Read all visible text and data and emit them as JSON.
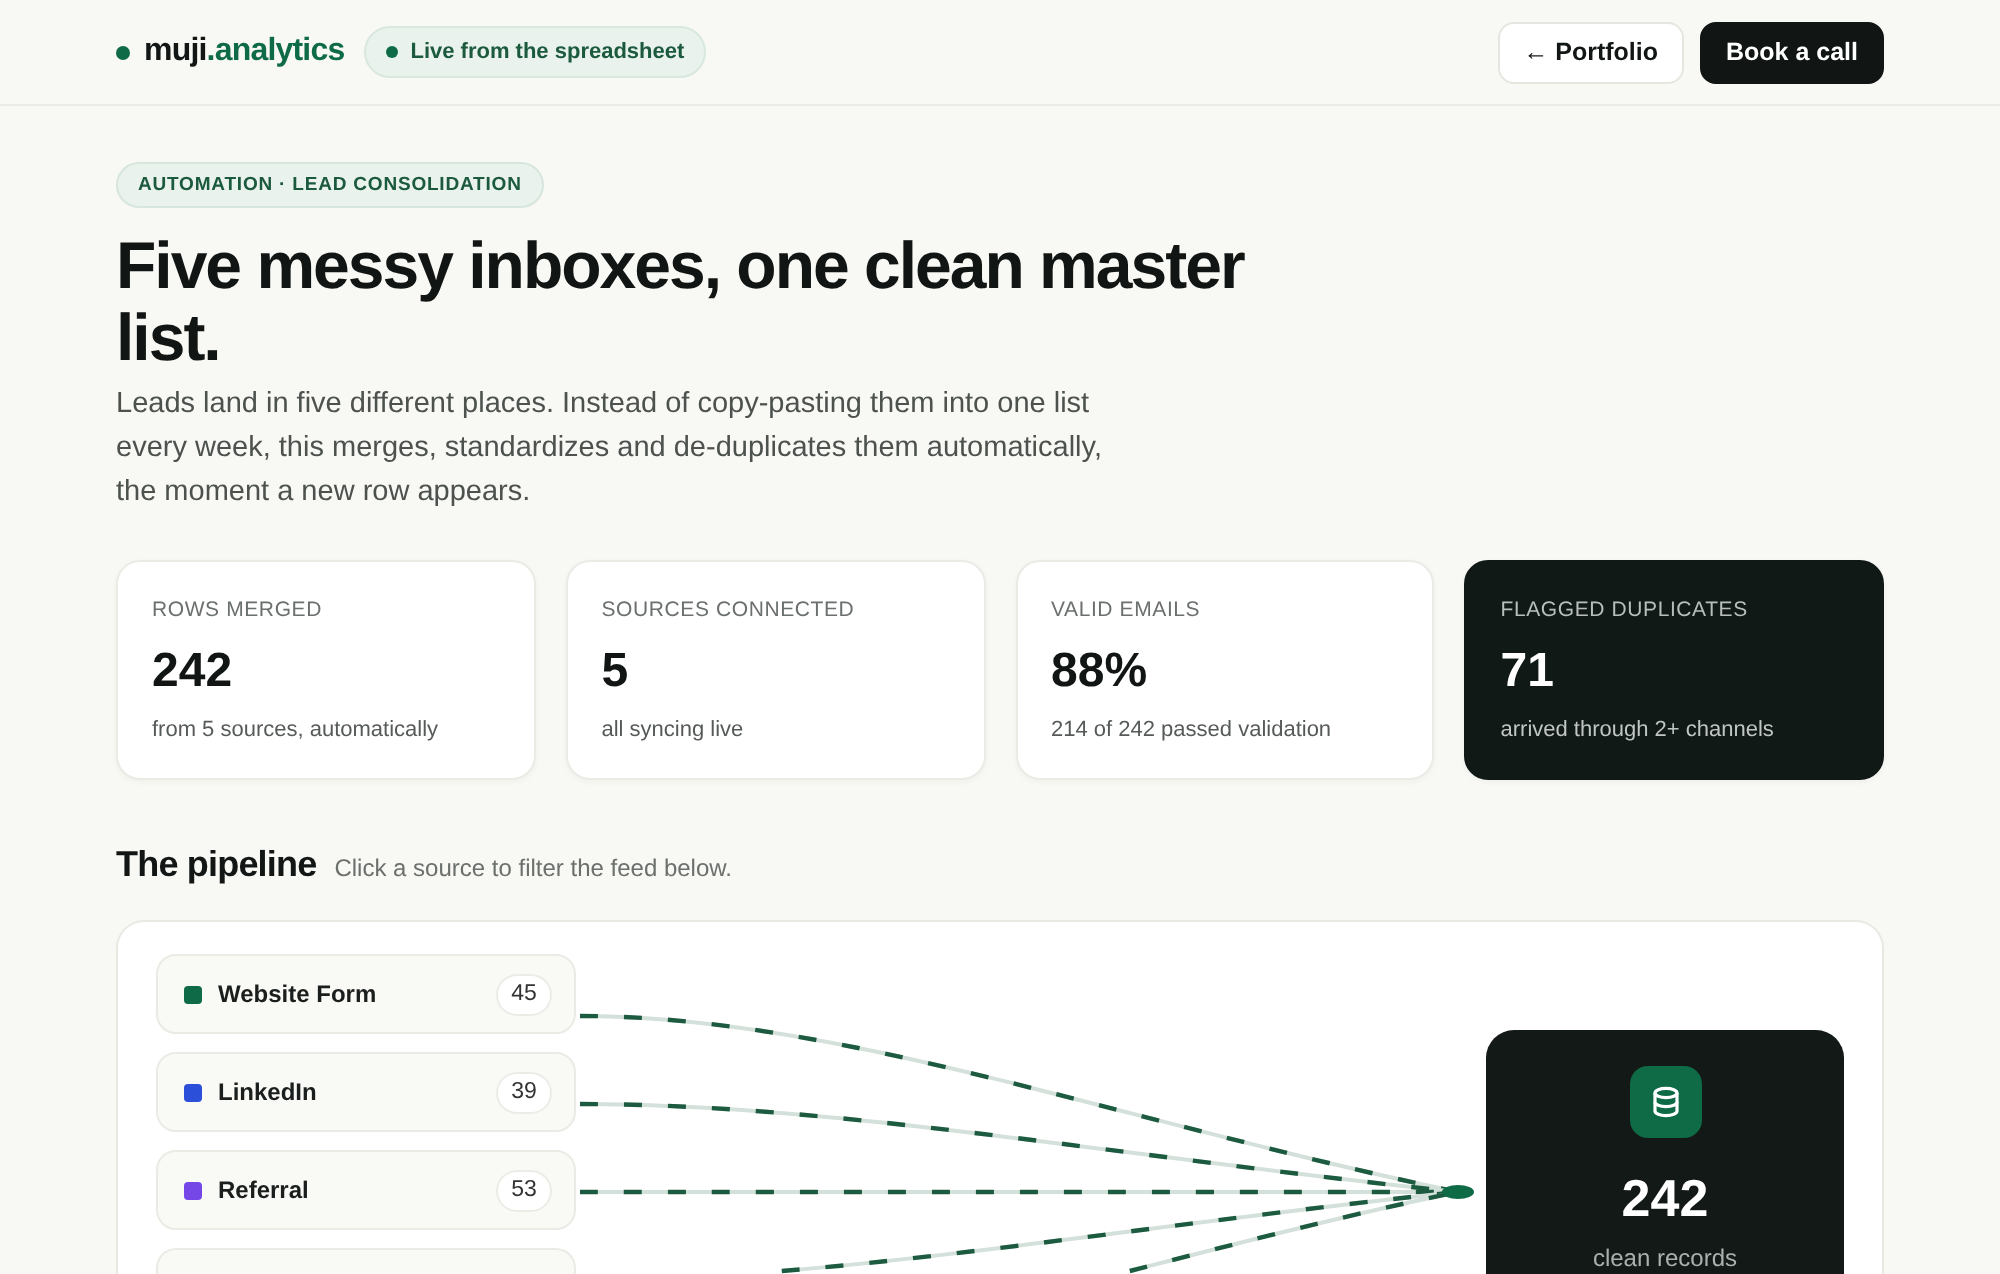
{
  "header": {
    "brand": {
      "primary": "muji",
      "accent": ".analytics"
    },
    "live_badge": {
      "label": "Live from the spreadsheet"
    },
    "buttons": [
      {
        "label": "← Portfolio",
        "kind": "secondary"
      },
      {
        "label": "Book a call",
        "kind": "primary"
      }
    ]
  },
  "hero": {
    "eyebrow": "AUTOMATION · LEAD CONSOLIDATION",
    "title": "Five messy inboxes, one clean master list.",
    "description": "Leads land in five different places. Instead of copy-pasting them into one list every week, this merges, standardizes and de-duplicates them automatically, the moment a new row appears."
  },
  "stats": [
    {
      "label": "ROWS MERGED",
      "value": "242",
      "note": "from 5 sources, automatically",
      "highlighted": false
    },
    {
      "label": "SOURCES CONNECTED",
      "value": "5",
      "note": "all syncing live",
      "highlighted": false
    },
    {
      "label": "VALID EMAILS",
      "value": "88%",
      "note": "214 of 242 passed validation",
      "highlighted": false
    },
    {
      "label": "FLAGGED DUPLICATES",
      "value": "71",
      "note": "arrived through 2+ channels",
      "highlighted": true
    }
  ],
  "pipeline": {
    "title": "The pipeline",
    "hint": "Click a source to filter the feed below.",
    "sources": [
      {
        "kind": "source",
        "name": "Website Form",
        "count": "45",
        "color": "#0f6b47",
        "selected": false
      },
      {
        "kind": "source",
        "name": "LinkedIn",
        "count": "39",
        "color": "#2b4fd8",
        "selected": false
      },
      {
        "kind": "source",
        "name": "Referral",
        "count": "53",
        "color": "#7447e6",
        "selected": false
      },
      {
        "kind": "clipped",
        "selected": false
      }
    ],
    "output": {
      "value": "242",
      "label": "clean records"
    }
  }
}
